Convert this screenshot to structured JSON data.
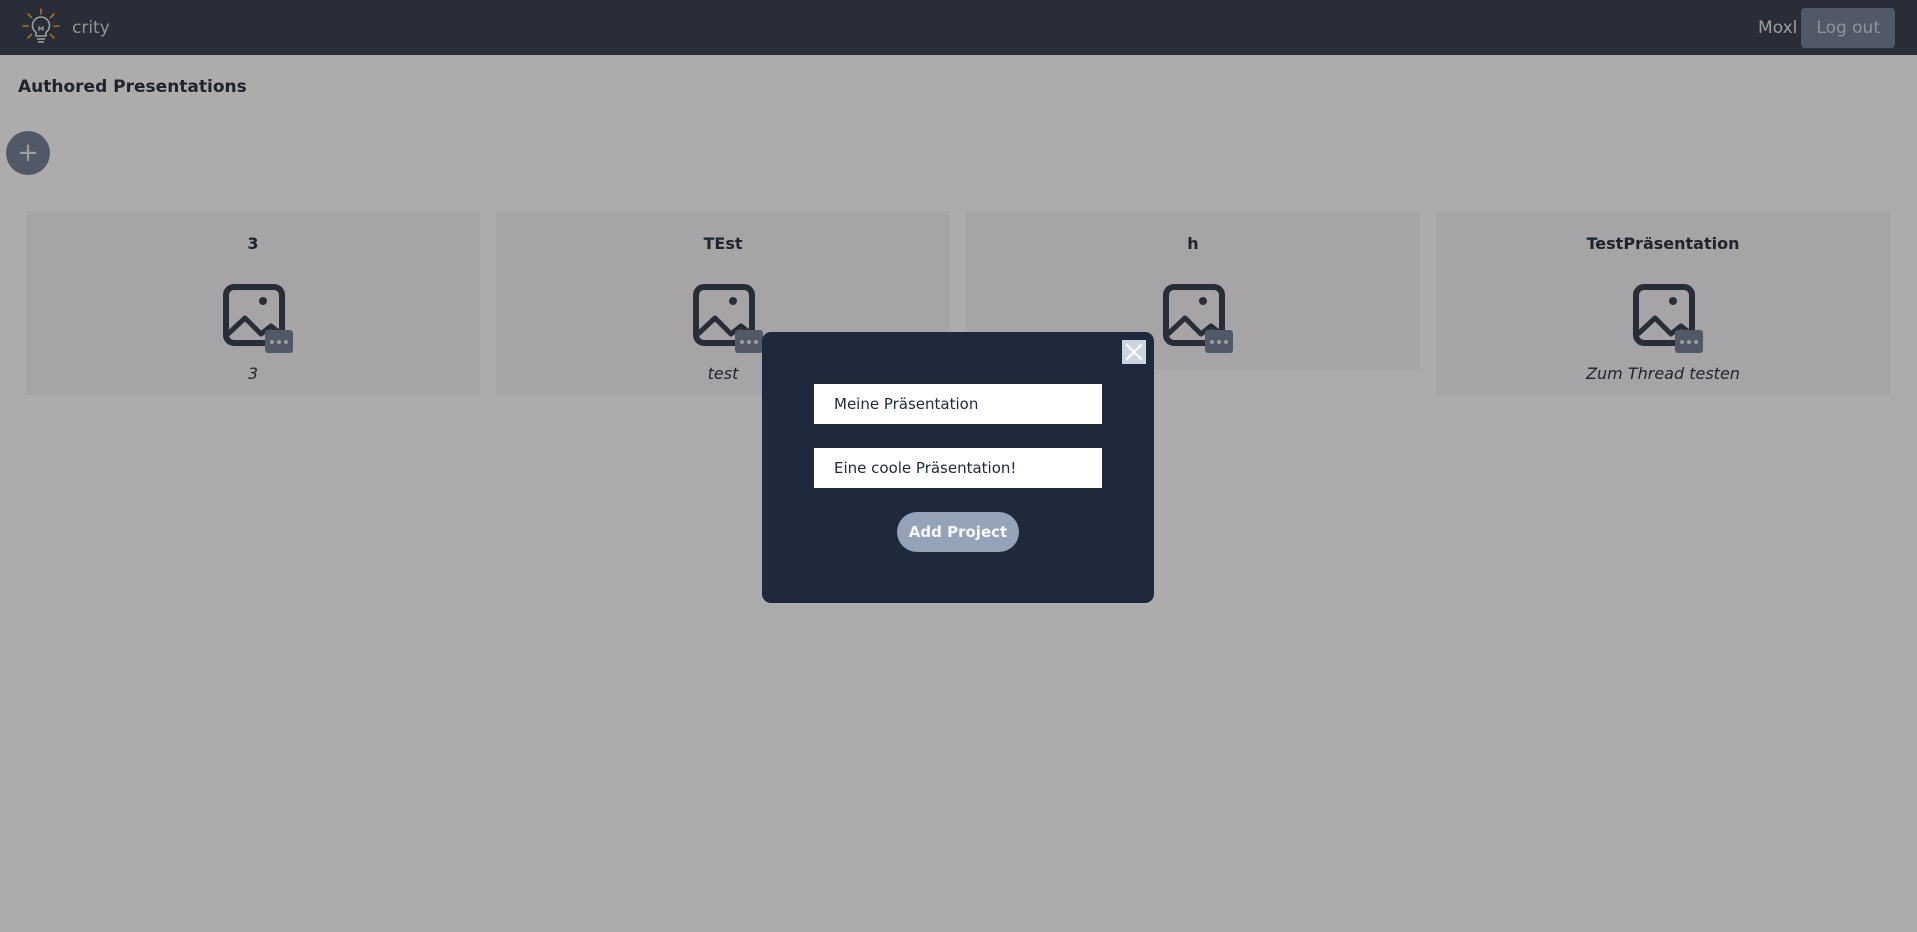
{
  "header": {
    "app_name": "crity",
    "logo_icon": "lightbulb-icon",
    "username": "Moxl",
    "logout_label": "Log out"
  },
  "main": {
    "title": "Authored Presentations",
    "add_button_label": "+"
  },
  "presentations": [
    {
      "title": "3",
      "description": "3",
      "image_icon": "image-placeholder-icon"
    },
    {
      "title": "TEst",
      "description": "test",
      "image_icon": "image-placeholder-icon"
    },
    {
      "title": "h",
      "description": "",
      "image_icon": "image-placeholder-icon"
    },
    {
      "title": "TestPräsentation",
      "description": "Zum Thread testen",
      "image_icon": "image-placeholder-icon"
    }
  ],
  "modal": {
    "title_input_value": "Meine Präsentation",
    "description_input_value": "Eine coole Präsentation!",
    "submit_label": "Add Project",
    "close_icon": "close-icon"
  },
  "colors": {
    "header_bg": "#1e293b",
    "modal_bg": "#1e293b",
    "accent_slate": "#64748b",
    "submit_bg": "#94a3b8",
    "logo_ray": "#f59e0b"
  }
}
